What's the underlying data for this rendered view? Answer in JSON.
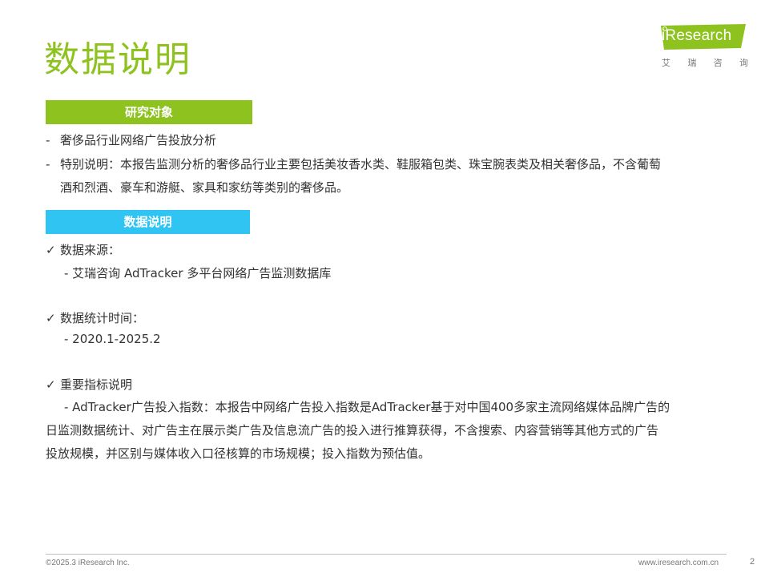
{
  "page": {
    "title": "数据说明"
  },
  "logo": {
    "text": "iResearch",
    "sub": [
      "艾",
      "瑞",
      "咨",
      "询"
    ],
    "color": "#8dc21f"
  },
  "section_research": {
    "label": "研究对象",
    "color": "#8dc21f",
    "items": [
      {
        "marker": "-",
        "text": "奢侈品行业网络广告投放分析"
      },
      {
        "marker": "-",
        "text": "特别说明：本报告监测分析的奢侈品行业主要包括美妆香水类、鞋服箱包类、珠宝腕表类及相关奢侈品，不含葡萄"
      },
      {
        "marker": "",
        "text": "酒和烈酒、豪车和游艇、家具和家纺等类别的奢侈品。"
      }
    ]
  },
  "section_data": {
    "label": "数据说明",
    "color": "#2fc4f2",
    "source_heading": "数据来源：",
    "source_value": "- 艾瑞咨询 AdTracker 多平台网络广告监测数据库",
    "period_heading": "数据统计时间：",
    "period_value": "- 2020.1-2025.2",
    "indicator_heading": "重要指标说明",
    "indicator_lines": [
      "- AdTracker广告投入指数：本报告中网络广告投入指数是AdTracker基于对中国400多家主流网络媒体品牌广告的",
      "日监测数据统计、对广告主在展示类广告及信息流广告的投入进行推算获得，不含搜索、内容营销等其他方式的广告",
      "投放规模，并区别与媒体收入口径核算的市场规模；投入指数为预估值。"
    ],
    "check_mark": "✓"
  },
  "footer": {
    "copyright": "©2025.3 iResearch Inc.",
    "website": "www.iresearch.com.cn",
    "page_number": "2"
  }
}
